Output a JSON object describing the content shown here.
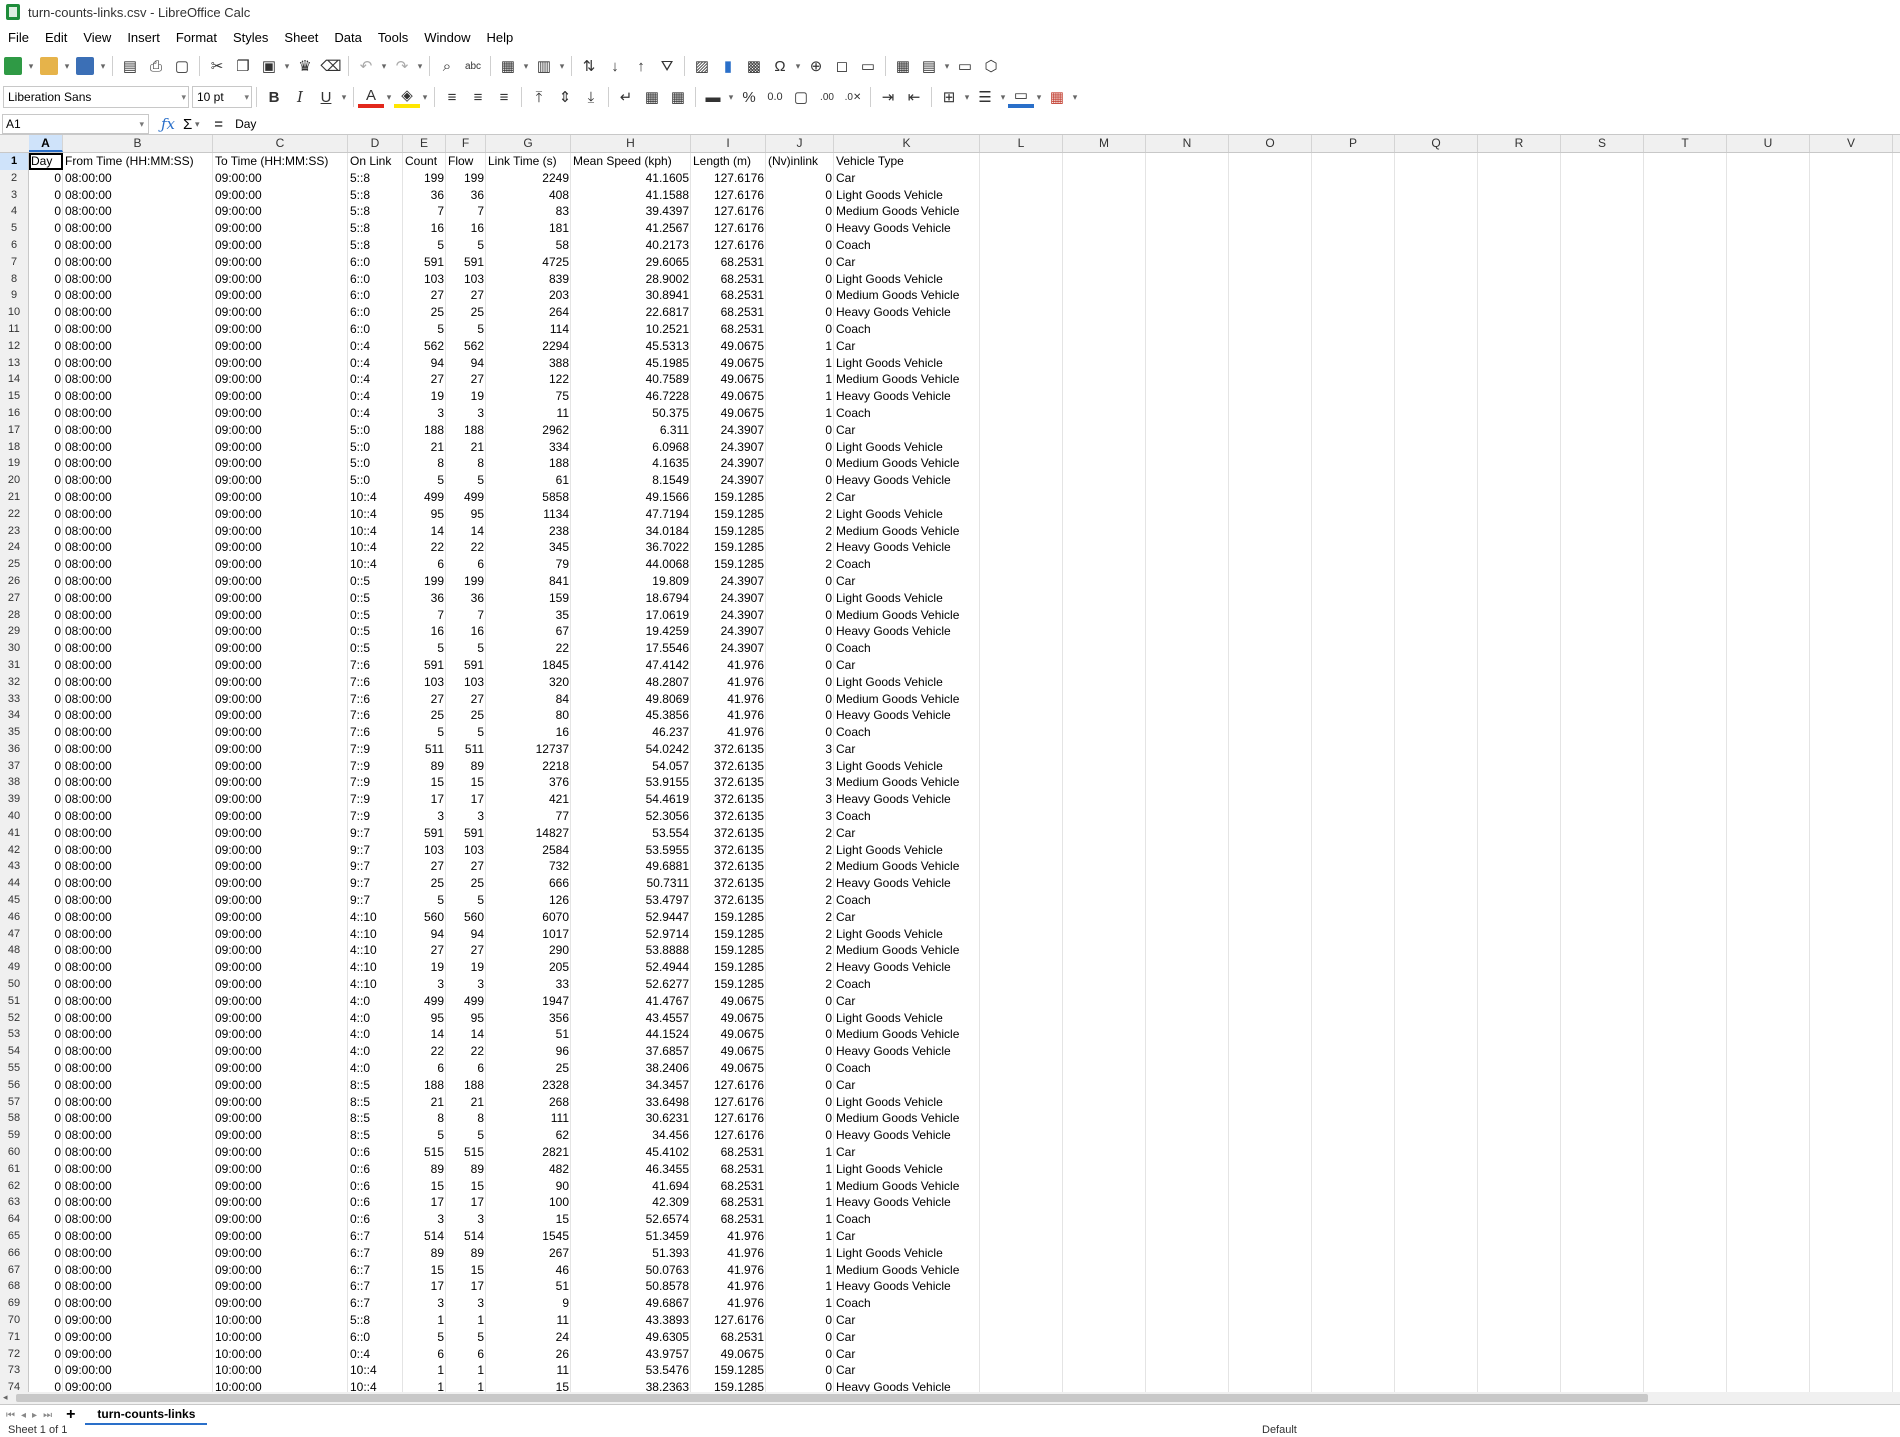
{
  "window": {
    "title": "turn-counts-links.csv - LibreOffice Calc"
  },
  "menu": [
    "File",
    "Edit",
    "View",
    "Insert",
    "Format",
    "Styles",
    "Sheet",
    "Data",
    "Tools",
    "Window",
    "Help"
  ],
  "format_toolbar": {
    "font_name": "Liberation Sans",
    "font_size": "10 pt"
  },
  "formula_bar": {
    "cell_ref": "A1",
    "content": "Day"
  },
  "columns": [
    "A",
    "B",
    "C",
    "D",
    "E",
    "F",
    "G",
    "H",
    "I",
    "J",
    "K",
    "L",
    "M",
    "N",
    "O",
    "P",
    "Q",
    "R",
    "S",
    "T",
    "U",
    "V"
  ],
  "rows": [
    [
      "Day",
      "From Time (HH:MM:SS)",
      "To Time (HH:MM:SS)",
      "On Link",
      "Count",
      "Flow",
      "Link Time (s)",
      "Mean Speed (kph)",
      "Length (m)",
      "(Nv)inlink",
      "Vehicle Type"
    ],
    [
      "0",
      "08:00:00",
      "09:00:00",
      "5::8",
      "199",
      "199",
      "2249",
      "41.1605",
      "127.6176",
      "0",
      "Car"
    ],
    [
      "0",
      "08:00:00",
      "09:00:00",
      "5::8",
      "36",
      "36",
      "408",
      "41.1588",
      "127.6176",
      "0",
      "Light Goods Vehicle"
    ],
    [
      "0",
      "08:00:00",
      "09:00:00",
      "5::8",
      "7",
      "7",
      "83",
      "39.4397",
      "127.6176",
      "0",
      "Medium Goods Vehicle"
    ],
    [
      "0",
      "08:00:00",
      "09:00:00",
      "5::8",
      "16",
      "16",
      "181",
      "41.2567",
      "127.6176",
      "0",
      "Heavy Goods Vehicle"
    ],
    [
      "0",
      "08:00:00",
      "09:00:00",
      "5::8",
      "5",
      "5",
      "58",
      "40.2173",
      "127.6176",
      "0",
      "Coach"
    ],
    [
      "0",
      "08:00:00",
      "09:00:00",
      "6::0",
      "591",
      "591",
      "4725",
      "29.6065",
      "68.2531",
      "0",
      "Car"
    ],
    [
      "0",
      "08:00:00",
      "09:00:00",
      "6::0",
      "103",
      "103",
      "839",
      "28.9002",
      "68.2531",
      "0",
      "Light Goods Vehicle"
    ],
    [
      "0",
      "08:00:00",
      "09:00:00",
      "6::0",
      "27",
      "27",
      "203",
      "30.8941",
      "68.2531",
      "0",
      "Medium Goods Vehicle"
    ],
    [
      "0",
      "08:00:00",
      "09:00:00",
      "6::0",
      "25",
      "25",
      "264",
      "22.6817",
      "68.2531",
      "0",
      "Heavy Goods Vehicle"
    ],
    [
      "0",
      "08:00:00",
      "09:00:00",
      "6::0",
      "5",
      "5",
      "114",
      "10.2521",
      "68.2531",
      "0",
      "Coach"
    ],
    [
      "0",
      "08:00:00",
      "09:00:00",
      "0::4",
      "562",
      "562",
      "2294",
      "45.5313",
      "49.0675",
      "1",
      "Car"
    ],
    [
      "0",
      "08:00:00",
      "09:00:00",
      "0::4",
      "94",
      "94",
      "388",
      "45.1985",
      "49.0675",
      "1",
      "Light Goods Vehicle"
    ],
    [
      "0",
      "08:00:00",
      "09:00:00",
      "0::4",
      "27",
      "27",
      "122",
      "40.7589",
      "49.0675",
      "1",
      "Medium Goods Vehicle"
    ],
    [
      "0",
      "08:00:00",
      "09:00:00",
      "0::4",
      "19",
      "19",
      "75",
      "46.7228",
      "49.0675",
      "1",
      "Heavy Goods Vehicle"
    ],
    [
      "0",
      "08:00:00",
      "09:00:00",
      "0::4",
      "3",
      "3",
      "11",
      "50.375",
      "49.0675",
      "1",
      "Coach"
    ],
    [
      "0",
      "08:00:00",
      "09:00:00",
      "5::0",
      "188",
      "188",
      "2962",
      "6.311",
      "24.3907",
      "0",
      "Car"
    ],
    [
      "0",
      "08:00:00",
      "09:00:00",
      "5::0",
      "21",
      "21",
      "334",
      "6.0968",
      "24.3907",
      "0",
      "Light Goods Vehicle"
    ],
    [
      "0",
      "08:00:00",
      "09:00:00",
      "5::0",
      "8",
      "8",
      "188",
      "4.1635",
      "24.3907",
      "0",
      "Medium Goods Vehicle"
    ],
    [
      "0",
      "08:00:00",
      "09:00:00",
      "5::0",
      "5",
      "5",
      "61",
      "8.1549",
      "24.3907",
      "0",
      "Heavy Goods Vehicle"
    ],
    [
      "0",
      "08:00:00",
      "09:00:00",
      "10::4",
      "499",
      "499",
      "5858",
      "49.1566",
      "159.1285",
      "2",
      "Car"
    ],
    [
      "0",
      "08:00:00",
      "09:00:00",
      "10::4",
      "95",
      "95",
      "1134",
      "47.7194",
      "159.1285",
      "2",
      "Light Goods Vehicle"
    ],
    [
      "0",
      "08:00:00",
      "09:00:00",
      "10::4",
      "14",
      "14",
      "238",
      "34.0184",
      "159.1285",
      "2",
      "Medium Goods Vehicle"
    ],
    [
      "0",
      "08:00:00",
      "09:00:00",
      "10::4",
      "22",
      "22",
      "345",
      "36.7022",
      "159.1285",
      "2",
      "Heavy Goods Vehicle"
    ],
    [
      "0",
      "08:00:00",
      "09:00:00",
      "10::4",
      "6",
      "6",
      "79",
      "44.0068",
      "159.1285",
      "2",
      "Coach"
    ],
    [
      "0",
      "08:00:00",
      "09:00:00",
      "0::5",
      "199",
      "199",
      "841",
      "19.809",
      "24.3907",
      "0",
      "Car"
    ],
    [
      "0",
      "08:00:00",
      "09:00:00",
      "0::5",
      "36",
      "36",
      "159",
      "18.6794",
      "24.3907",
      "0",
      "Light Goods Vehicle"
    ],
    [
      "0",
      "08:00:00",
      "09:00:00",
      "0::5",
      "7",
      "7",
      "35",
      "17.0619",
      "24.3907",
      "0",
      "Medium Goods Vehicle"
    ],
    [
      "0",
      "08:00:00",
      "09:00:00",
      "0::5",
      "16",
      "16",
      "67",
      "19.4259",
      "24.3907",
      "0",
      "Heavy Goods Vehicle"
    ],
    [
      "0",
      "08:00:00",
      "09:00:00",
      "0::5",
      "5",
      "5",
      "22",
      "17.5546",
      "24.3907",
      "0",
      "Coach"
    ],
    [
      "0",
      "08:00:00",
      "09:00:00",
      "7::6",
      "591",
      "591",
      "1845",
      "47.4142",
      "41.976",
      "0",
      "Car"
    ],
    [
      "0",
      "08:00:00",
      "09:00:00",
      "7::6",
      "103",
      "103",
      "320",
      "48.2807",
      "41.976",
      "0",
      "Light Goods Vehicle"
    ],
    [
      "0",
      "08:00:00",
      "09:00:00",
      "7::6",
      "27",
      "27",
      "84",
      "49.8069",
      "41.976",
      "0",
      "Medium Goods Vehicle"
    ],
    [
      "0",
      "08:00:00",
      "09:00:00",
      "7::6",
      "25",
      "25",
      "80",
      "45.3856",
      "41.976",
      "0",
      "Heavy Goods Vehicle"
    ],
    [
      "0",
      "08:00:00",
      "09:00:00",
      "7::6",
      "5",
      "5",
      "16",
      "46.237",
      "41.976",
      "0",
      "Coach"
    ],
    [
      "0",
      "08:00:00",
      "09:00:00",
      "7::9",
      "511",
      "511",
      "12737",
      "54.0242",
      "372.6135",
      "3",
      "Car"
    ],
    [
      "0",
      "08:00:00",
      "09:00:00",
      "7::9",
      "89",
      "89",
      "2218",
      "54.057",
      "372.6135",
      "3",
      "Light Goods Vehicle"
    ],
    [
      "0",
      "08:00:00",
      "09:00:00",
      "7::9",
      "15",
      "15",
      "376",
      "53.9155",
      "372.6135",
      "3",
      "Medium Goods Vehicle"
    ],
    [
      "0",
      "08:00:00",
      "09:00:00",
      "7::9",
      "17",
      "17",
      "421",
      "54.4619",
      "372.6135",
      "3",
      "Heavy Goods Vehicle"
    ],
    [
      "0",
      "08:00:00",
      "09:00:00",
      "7::9",
      "3",
      "3",
      "77",
      "52.3056",
      "372.6135",
      "3",
      "Coach"
    ],
    [
      "0",
      "08:00:00",
      "09:00:00",
      "9::7",
      "591",
      "591",
      "14827",
      "53.554",
      "372.6135",
      "2",
      "Car"
    ],
    [
      "0",
      "08:00:00",
      "09:00:00",
      "9::7",
      "103",
      "103",
      "2584",
      "53.5955",
      "372.6135",
      "2",
      "Light Goods Vehicle"
    ],
    [
      "0",
      "08:00:00",
      "09:00:00",
      "9::7",
      "27",
      "27",
      "732",
      "49.6881",
      "372.6135",
      "2",
      "Medium Goods Vehicle"
    ],
    [
      "0",
      "08:00:00",
      "09:00:00",
      "9::7",
      "25",
      "25",
      "666",
      "50.7311",
      "372.6135",
      "2",
      "Heavy Goods Vehicle"
    ],
    [
      "0",
      "08:00:00",
      "09:00:00",
      "9::7",
      "5",
      "5",
      "126",
      "53.4797",
      "372.6135",
      "2",
      "Coach"
    ],
    [
      "0",
      "08:00:00",
      "09:00:00",
      "4::10",
      "560",
      "560",
      "6070",
      "52.9447",
      "159.1285",
      "2",
      "Car"
    ],
    [
      "0",
      "08:00:00",
      "09:00:00",
      "4::10",
      "94",
      "94",
      "1017",
      "52.9714",
      "159.1285",
      "2",
      "Light Goods Vehicle"
    ],
    [
      "0",
      "08:00:00",
      "09:00:00",
      "4::10",
      "27",
      "27",
      "290",
      "53.8888",
      "159.1285",
      "2",
      "Medium Goods Vehicle"
    ],
    [
      "0",
      "08:00:00",
      "09:00:00",
      "4::10",
      "19",
      "19",
      "205",
      "52.4944",
      "159.1285",
      "2",
      "Heavy Goods Vehicle"
    ],
    [
      "0",
      "08:00:00",
      "09:00:00",
      "4::10",
      "3",
      "3",
      "33",
      "52.6277",
      "159.1285",
      "2",
      "Coach"
    ],
    [
      "0",
      "08:00:00",
      "09:00:00",
      "4::0",
      "499",
      "499",
      "1947",
      "41.4767",
      "49.0675",
      "0",
      "Car"
    ],
    [
      "0",
      "08:00:00",
      "09:00:00",
      "4::0",
      "95",
      "95",
      "356",
      "43.4557",
      "49.0675",
      "0",
      "Light Goods Vehicle"
    ],
    [
      "0",
      "08:00:00",
      "09:00:00",
      "4::0",
      "14",
      "14",
      "51",
      "44.1524",
      "49.0675",
      "0",
      "Medium Goods Vehicle"
    ],
    [
      "0",
      "08:00:00",
      "09:00:00",
      "4::0",
      "22",
      "22",
      "96",
      "37.6857",
      "49.0675",
      "0",
      "Heavy Goods Vehicle"
    ],
    [
      "0",
      "08:00:00",
      "09:00:00",
      "4::0",
      "6",
      "6",
      "25",
      "38.2406",
      "49.0675",
      "0",
      "Coach"
    ],
    [
      "0",
      "08:00:00",
      "09:00:00",
      "8::5",
      "188",
      "188",
      "2328",
      "34.3457",
      "127.6176",
      "0",
      "Car"
    ],
    [
      "0",
      "08:00:00",
      "09:00:00",
      "8::5",
      "21",
      "21",
      "268",
      "33.6498",
      "127.6176",
      "0",
      "Light Goods Vehicle"
    ],
    [
      "0",
      "08:00:00",
      "09:00:00",
      "8::5",
      "8",
      "8",
      "111",
      "30.6231",
      "127.6176",
      "0",
      "Medium Goods Vehicle"
    ],
    [
      "0",
      "08:00:00",
      "09:00:00",
      "8::5",
      "5",
      "5",
      "62",
      "34.456",
      "127.6176",
      "0",
      "Heavy Goods Vehicle"
    ],
    [
      "0",
      "08:00:00",
      "09:00:00",
      "0::6",
      "515",
      "515",
      "2821",
      "45.4102",
      "68.2531",
      "1",
      "Car"
    ],
    [
      "0",
      "08:00:00",
      "09:00:00",
      "0::6",
      "89",
      "89",
      "482",
      "46.3455",
      "68.2531",
      "1",
      "Light Goods Vehicle"
    ],
    [
      "0",
      "08:00:00",
      "09:00:00",
      "0::6",
      "15",
      "15",
      "90",
      "41.694",
      "68.2531",
      "1",
      "Medium Goods Vehicle"
    ],
    [
      "0",
      "08:00:00",
      "09:00:00",
      "0::6",
      "17",
      "17",
      "100",
      "42.309",
      "68.2531",
      "1",
      "Heavy Goods Vehicle"
    ],
    [
      "0",
      "08:00:00",
      "09:00:00",
      "0::6",
      "3",
      "3",
      "15",
      "52.6574",
      "68.2531",
      "1",
      "Coach"
    ],
    [
      "0",
      "08:00:00",
      "09:00:00",
      "6::7",
      "514",
      "514",
      "1545",
      "51.3459",
      "41.976",
      "1",
      "Car"
    ],
    [
      "0",
      "08:00:00",
      "09:00:00",
      "6::7",
      "89",
      "89",
      "267",
      "51.393",
      "41.976",
      "1",
      "Light Goods Vehicle"
    ],
    [
      "0",
      "08:00:00",
      "09:00:00",
      "6::7",
      "15",
      "15",
      "46",
      "50.0763",
      "41.976",
      "1",
      "Medium Goods Vehicle"
    ],
    [
      "0",
      "08:00:00",
      "09:00:00",
      "6::7",
      "17",
      "17",
      "51",
      "50.8578",
      "41.976",
      "1",
      "Heavy Goods Vehicle"
    ],
    [
      "0",
      "08:00:00",
      "09:00:00",
      "6::7",
      "3",
      "3",
      "9",
      "49.6867",
      "41.976",
      "1",
      "Coach"
    ],
    [
      "0",
      "09:00:00",
      "10:00:00",
      "5::8",
      "1",
      "1",
      "11",
      "43.3893",
      "127.6176",
      "0",
      "Car"
    ],
    [
      "0",
      "09:00:00",
      "10:00:00",
      "6::0",
      "5",
      "5",
      "24",
      "49.6305",
      "68.2531",
      "0",
      "Car"
    ],
    [
      "0",
      "09:00:00",
      "10:00:00",
      "0::4",
      "6",
      "6",
      "26",
      "43.9757",
      "49.0675",
      "0",
      "Car"
    ],
    [
      "0",
      "09:00:00",
      "10:00:00",
      "10::4",
      "1",
      "1",
      "11",
      "53.5476",
      "159.1285",
      "0",
      "Car"
    ],
    [
      "0",
      "09:00:00",
      "10:00:00",
      "10::4",
      "1",
      "1",
      "15",
      "38.2363",
      "159.1285",
      "0",
      "Heavy Goods Vehicle"
    ]
  ],
  "sheet_tab": "turn-counts-links",
  "status": {
    "sheet_info": "Sheet 1 of 1",
    "page_style": "Default"
  }
}
